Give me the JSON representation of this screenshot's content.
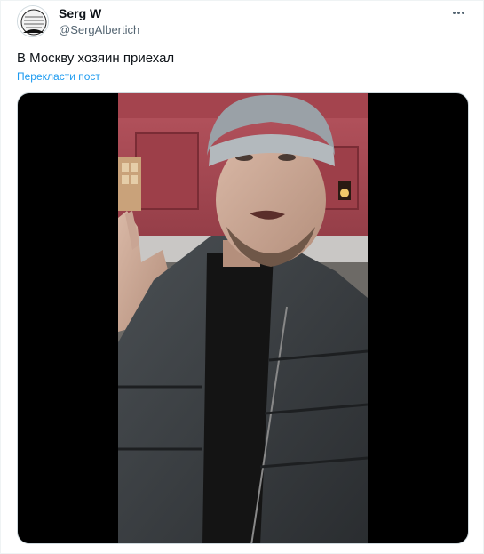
{
  "author": {
    "display_name": "Serg W",
    "handle": "@SergAlbertich",
    "avatar_icon": "avatar-image"
  },
  "menu": {
    "icon": "more-options-icon"
  },
  "tweet": {
    "text": "В Москву хозяин приехал",
    "translate_label": "Перекласти пост"
  },
  "media": {
    "type": "video",
    "thumbnail_icon": "video-thumbnail"
  },
  "colors": {
    "link": "#1d9bf0",
    "text": "#0f1419",
    "secondary": "#536471",
    "media_bg": "#000000"
  }
}
